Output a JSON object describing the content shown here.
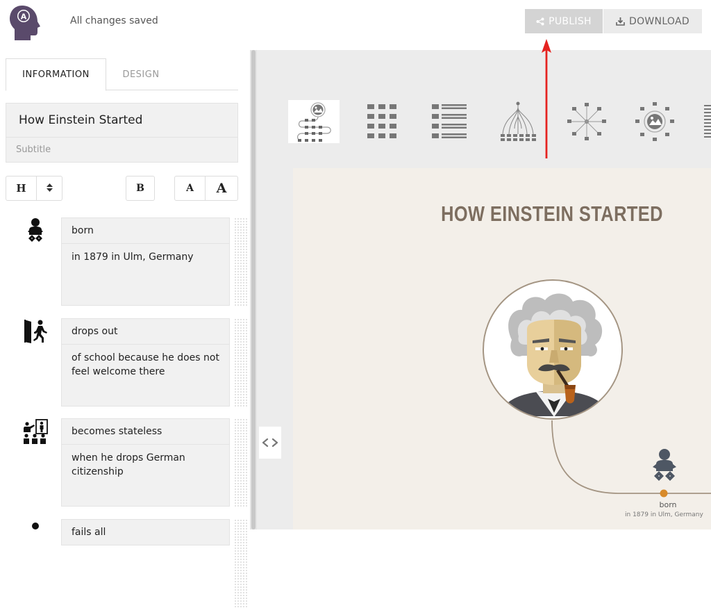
{
  "header": {
    "save_status": "All changes saved",
    "publish_label": "PUBLISH",
    "download_label": "DOWNLOAD"
  },
  "left_panel": {
    "tabs": [
      {
        "label": "INFORMATION",
        "active": true
      },
      {
        "label": "DESIGN",
        "active": false
      }
    ],
    "title_value": "How Einstein Started",
    "subtitle_placeholder": "Subtitle",
    "format": {
      "heading": "H",
      "bold": "B",
      "small_a": "A",
      "large_a": "A"
    },
    "entries": [
      {
        "icon": "baby-icon",
        "label": "born",
        "desc": "in 1879 in Ulm, Germany"
      },
      {
        "icon": "exit-door-icon",
        "label": "drops out",
        "desc": "of school because he does not feel welcome there"
      },
      {
        "icon": "classroom-icon",
        "label": "becomes stateless",
        "desc": "when he drops German citizenship"
      },
      {
        "icon": "person-icon",
        "label": "fails all",
        "desc": ""
      }
    ]
  },
  "canvas": {
    "title": "HOW EINSTEIN STARTED",
    "timeline_first_label": "born",
    "timeline_first_desc": "in 1879 in Ulm, Germany"
  },
  "colors": {
    "publish_bg": "#d4d4d4",
    "download_bg": "#ebebeb",
    "canvas_bg": "#f3efe9",
    "title_color": "#7d6e60",
    "timeline_dot": "#d88a2a",
    "annotation_arrow": "#e52320"
  }
}
